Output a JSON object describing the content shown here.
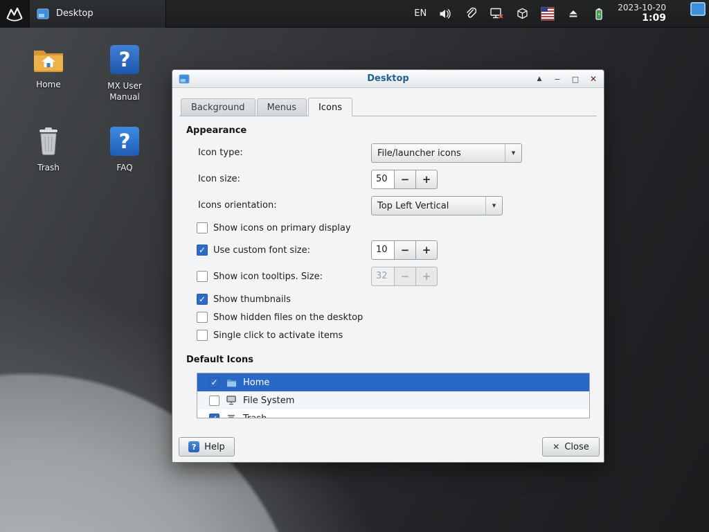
{
  "panel": {
    "task_button_label": "Desktop",
    "tray": {
      "language": "EN",
      "date": "2023-10-20",
      "time": "1:09"
    }
  },
  "desktop_icons": [
    {
      "label": "Home"
    },
    {
      "label": "MX User Manual"
    },
    {
      "label": "Trash"
    },
    {
      "label": "FAQ"
    }
  ],
  "dialog": {
    "title": "Desktop",
    "tabs": [
      {
        "label": "Background"
      },
      {
        "label": "Menus"
      },
      {
        "label": "Icons"
      }
    ],
    "active_tab": "Icons",
    "sections": {
      "appearance": "Appearance",
      "default_icons": "Default Icons"
    },
    "fields": {
      "icon_type": {
        "label": "Icon type:",
        "value": "File/launcher icons"
      },
      "icon_size": {
        "label": "Icon size:",
        "value": "50"
      },
      "orientation": {
        "label": "Icons orientation:",
        "value": "Top Left Vertical"
      },
      "font_size": {
        "label": "Use custom font size:",
        "value": "10",
        "checked": true
      },
      "tooltips": {
        "label": "Show icon tooltips. Size:",
        "value": "32",
        "checked": false,
        "enabled": false
      }
    },
    "checkboxes": {
      "primary_display": {
        "label": "Show icons on primary display",
        "checked": false
      },
      "thumbnails": {
        "label": "Show thumbnails",
        "checked": true
      },
      "hidden_files": {
        "label": "Show hidden files on the desktop",
        "checked": false
      },
      "single_click": {
        "label": "Single click to activate items",
        "checked": false
      }
    },
    "icon_list": [
      {
        "label": "Home",
        "checked": true,
        "selected": true
      },
      {
        "label": "File System",
        "checked": false,
        "selected": false
      },
      {
        "label": "Trash",
        "checked": true,
        "selected": false
      }
    ],
    "buttons": {
      "help": "Help",
      "close": "Close"
    }
  },
  "icons": {
    "check": "✓",
    "dropdown_arrow": "▾",
    "shade": "▲",
    "minimize": "−",
    "maximize": "□",
    "close": "✕",
    "help": "?",
    "minus": "−",
    "plus": "+"
  },
  "colors": {
    "selection_blue": "#2968c4",
    "checkbox_blue": "#2e6bc6",
    "panel_dark": "#1b1d1f",
    "titlebar_text": "#1f6290"
  }
}
